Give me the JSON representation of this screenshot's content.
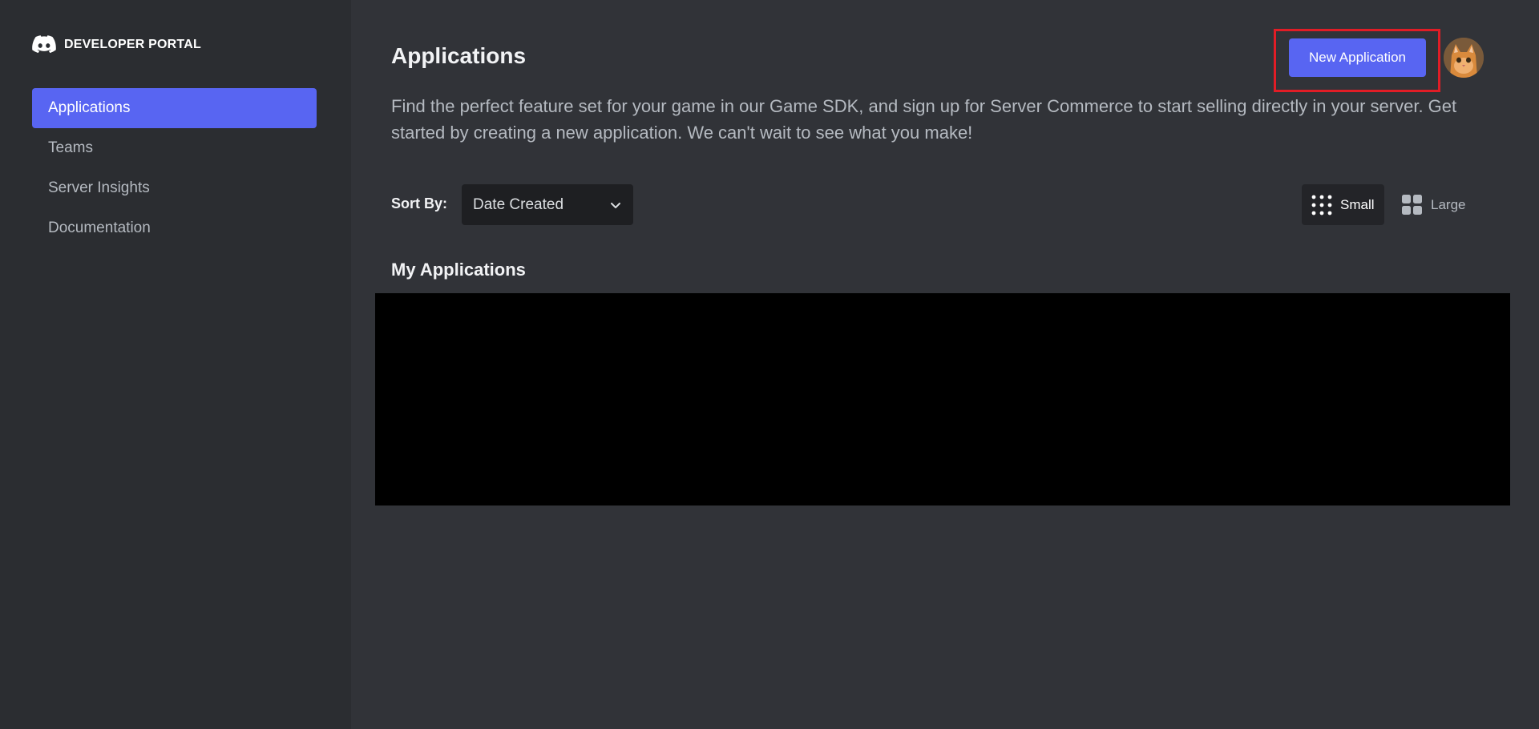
{
  "brand": {
    "text": "DEVELOPER PORTAL",
    "icon": "discord-logo-icon"
  },
  "sidebar": {
    "items": [
      {
        "label": "Applications",
        "active": true
      },
      {
        "label": "Teams",
        "active": false
      },
      {
        "label": "Server Insights",
        "active": false
      },
      {
        "label": "Documentation",
        "active": false
      }
    ]
  },
  "header": {
    "title": "Applications",
    "new_button": "New Application",
    "description": "Find the perfect feature set for your game in our Game SDK, and sign up for Server Commerce to start selling directly in your server. Get started by creating a new application. We can't wait to see what you make!"
  },
  "sort": {
    "label": "Sort By:",
    "selected": "Date Created",
    "icon": "chevron-down-icon"
  },
  "view_toggle": {
    "small": {
      "label": "Small",
      "icon": "small-grid-icon",
      "active": true
    },
    "large": {
      "label": "Large",
      "icon": "large-grid-icon",
      "active": false
    }
  },
  "section": {
    "title": "My Applications"
  },
  "colors": {
    "accent": "#5865f2",
    "highlight": "#e11d26",
    "sidebar_bg": "#2b2d31",
    "main_bg": "#313338"
  }
}
